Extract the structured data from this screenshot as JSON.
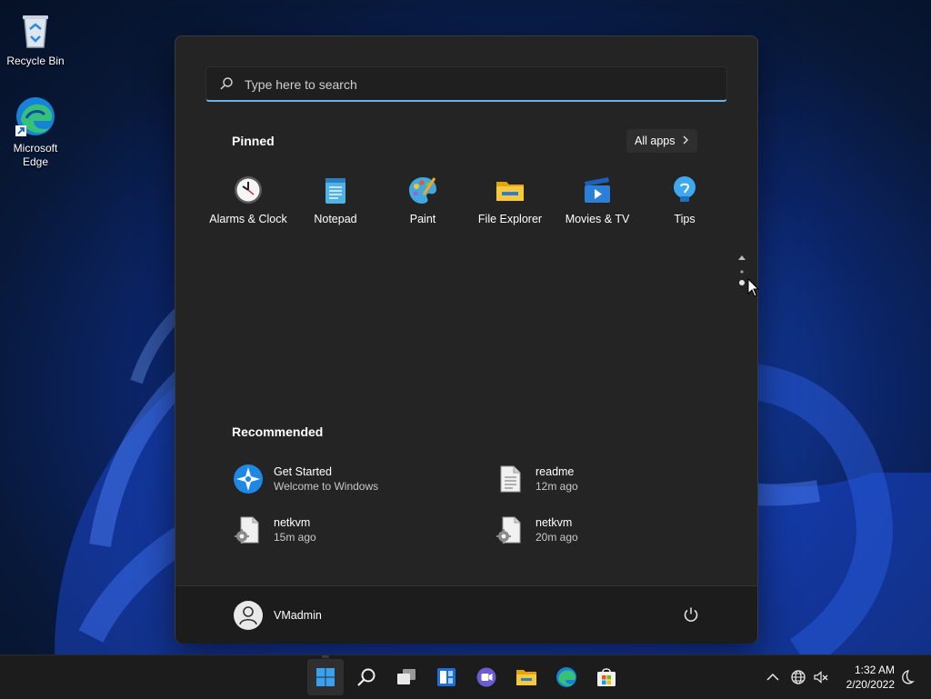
{
  "desktop": {
    "icons": [
      {
        "label": "Recycle Bin",
        "icon": "recycle-bin-icon"
      },
      {
        "label": "Microsoft Edge",
        "icon": "edge-icon"
      }
    ]
  },
  "start_menu": {
    "search": {
      "placeholder": "Type here to search"
    },
    "pinned": {
      "title": "Pinned",
      "all_apps_label": "All apps",
      "apps": [
        {
          "label": "Alarms & Clock",
          "icon": "alarms-clock-icon"
        },
        {
          "label": "Notepad",
          "icon": "notepad-icon"
        },
        {
          "label": "Paint",
          "icon": "paint-icon"
        },
        {
          "label": "File Explorer",
          "icon": "file-explorer-icon"
        },
        {
          "label": "Movies & TV",
          "icon": "movies-tv-icon"
        },
        {
          "label": "Tips",
          "icon": "tips-icon"
        }
      ]
    },
    "recommended": {
      "title": "Recommended",
      "items": [
        {
          "title": "Get Started",
          "subtitle": "Welcome to Windows",
          "icon": "get-started-icon"
        },
        {
          "title": "readme",
          "subtitle": "12m ago",
          "icon": "document-icon"
        },
        {
          "title": "netkvm",
          "subtitle": "15m ago",
          "icon": "system-file-icon"
        },
        {
          "title": "netkvm",
          "subtitle": "20m ago",
          "icon": "system-file-icon"
        }
      ]
    },
    "user": {
      "name": "VMadmin",
      "icon": "user-avatar-icon"
    },
    "power_icon": "power-icon"
  },
  "taskbar": {
    "apps": [
      "start-icon",
      "search-icon",
      "task-view-icon",
      "widgets-icon",
      "teams-chat-icon",
      "file-explorer-icon",
      "edge-icon",
      "store-icon"
    ],
    "tray": [
      "chevron-up-icon",
      "network-icon",
      "speaker-muted-icon",
      "moon-icon"
    ],
    "time": "1:32 AM",
    "date": "2/20/2022"
  },
  "colors": {
    "accent": "#6cb2e8",
    "start_bg": "#242424",
    "taskbar_bg": "#1c1c1c"
  }
}
